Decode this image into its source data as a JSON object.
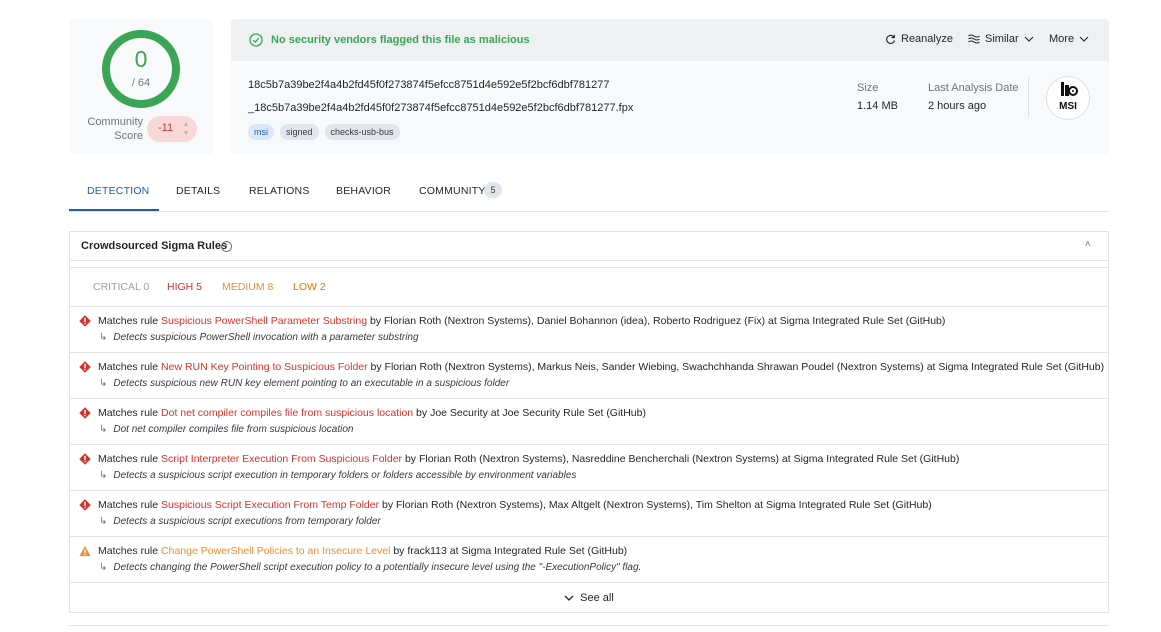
{
  "score": {
    "detected": "0",
    "total": "/ 64",
    "community_label_1": "Community",
    "community_label_2": "Score",
    "community_value": "-11"
  },
  "header": {
    "status": "No security vendors flagged this file as malicious",
    "reanalyze": "Reanalyze",
    "similar": "Similar",
    "more": "More"
  },
  "file": {
    "hash": "18c5b7a39be2f4a4b2fd45f0f273874f5efcc8751d4e592e5f2bcf6dbf781277",
    "name": "_18c5b7a39be2f4a4b2fd45f0f273874f5efcc8751d4e592e5f2bcf6dbf781277.fpx",
    "tags": [
      "msi",
      "signed",
      "checks-usb-bus"
    ],
    "size_label": "Size",
    "size_value": "1.14 MB",
    "last_label": "Last Analysis Date",
    "last_value": "2 hours ago",
    "type_badge": "MSI"
  },
  "tabs": [
    "DETECTION",
    "DETAILS",
    "RELATIONS",
    "BEHAVIOR",
    "COMMUNITY"
  ],
  "community_count": "5",
  "panel": {
    "title": "Crowdsourced Sigma Rules",
    "severities": [
      {
        "label": "CRITICAL 0",
        "color": "#9aa0a6"
      },
      {
        "label": "HIGH 5",
        "color": "#d0342c"
      },
      {
        "label": "MEDIUM 8",
        "color": "#e8903a"
      },
      {
        "label": "LOW 2",
        "color": "#e07b00"
      }
    ],
    "rules": [
      {
        "level": "high",
        "prefix": "Matches rule ",
        "name": "Suspicious PowerShell Parameter Substring",
        "suffix": " by Florian Roth (Nextron Systems), Daniel Bohannon (idea), Roberto Rodriguez (Fix) at Sigma Integrated Rule Set (GitHub)",
        "desc": "Detects suspicious PowerShell invocation with a parameter substring"
      },
      {
        "level": "high",
        "prefix": "Matches rule ",
        "name": "New RUN Key Pointing to Suspicious Folder",
        "suffix": " by Florian Roth (Nextron Systems), Markus Neis, Sander Wiebing, Swachchhanda Shrawan Poudel (Nextron Systems) at Sigma Integrated Rule Set (GitHub)",
        "desc": "Detects suspicious new RUN key element pointing to an executable in a suspicious folder"
      },
      {
        "level": "high",
        "prefix": "Matches rule ",
        "name": "Dot net compiler compiles file from suspicious location",
        "suffix": " by Joe Security at Joe Security Rule Set (GitHub)",
        "desc": "Dot net compiler compiles file from suspicious location"
      },
      {
        "level": "high",
        "prefix": "Matches rule ",
        "name": "Script Interpreter Execution From Suspicious Folder",
        "suffix": " by Florian Roth (Nextron Systems), Nasreddine Bencherchali (Nextron Systems) at Sigma Integrated Rule Set (GitHub)",
        "desc": "Detects a suspicious script execution in temporary folders or folders accessible by environment variables"
      },
      {
        "level": "high",
        "prefix": "Matches rule ",
        "name": "Suspicious Script Execution From Temp Folder",
        "suffix": " by Florian Roth (Nextron Systems), Max Altgelt (Nextron Systems), Tim Shelton at Sigma Integrated Rule Set (GitHub)",
        "desc": "Detects a suspicious script executions from temporary folder"
      },
      {
        "level": "medium",
        "prefix": "Matches rule ",
        "name": "Change PowerShell Policies to an Insecure Level",
        "suffix": " by frack113 at Sigma Integrated Rule Set (GitHub)",
        "desc": "Detects changing the PowerShell script execution policy to a potentially insecure level using the \"-ExecutionPolicy\" flag."
      }
    ],
    "see_all": "See all"
  },
  "colors": {
    "ok": "#3aa655",
    "high": "#d0342c",
    "medium": "#e8903a",
    "accent": "#1f5fa8"
  }
}
